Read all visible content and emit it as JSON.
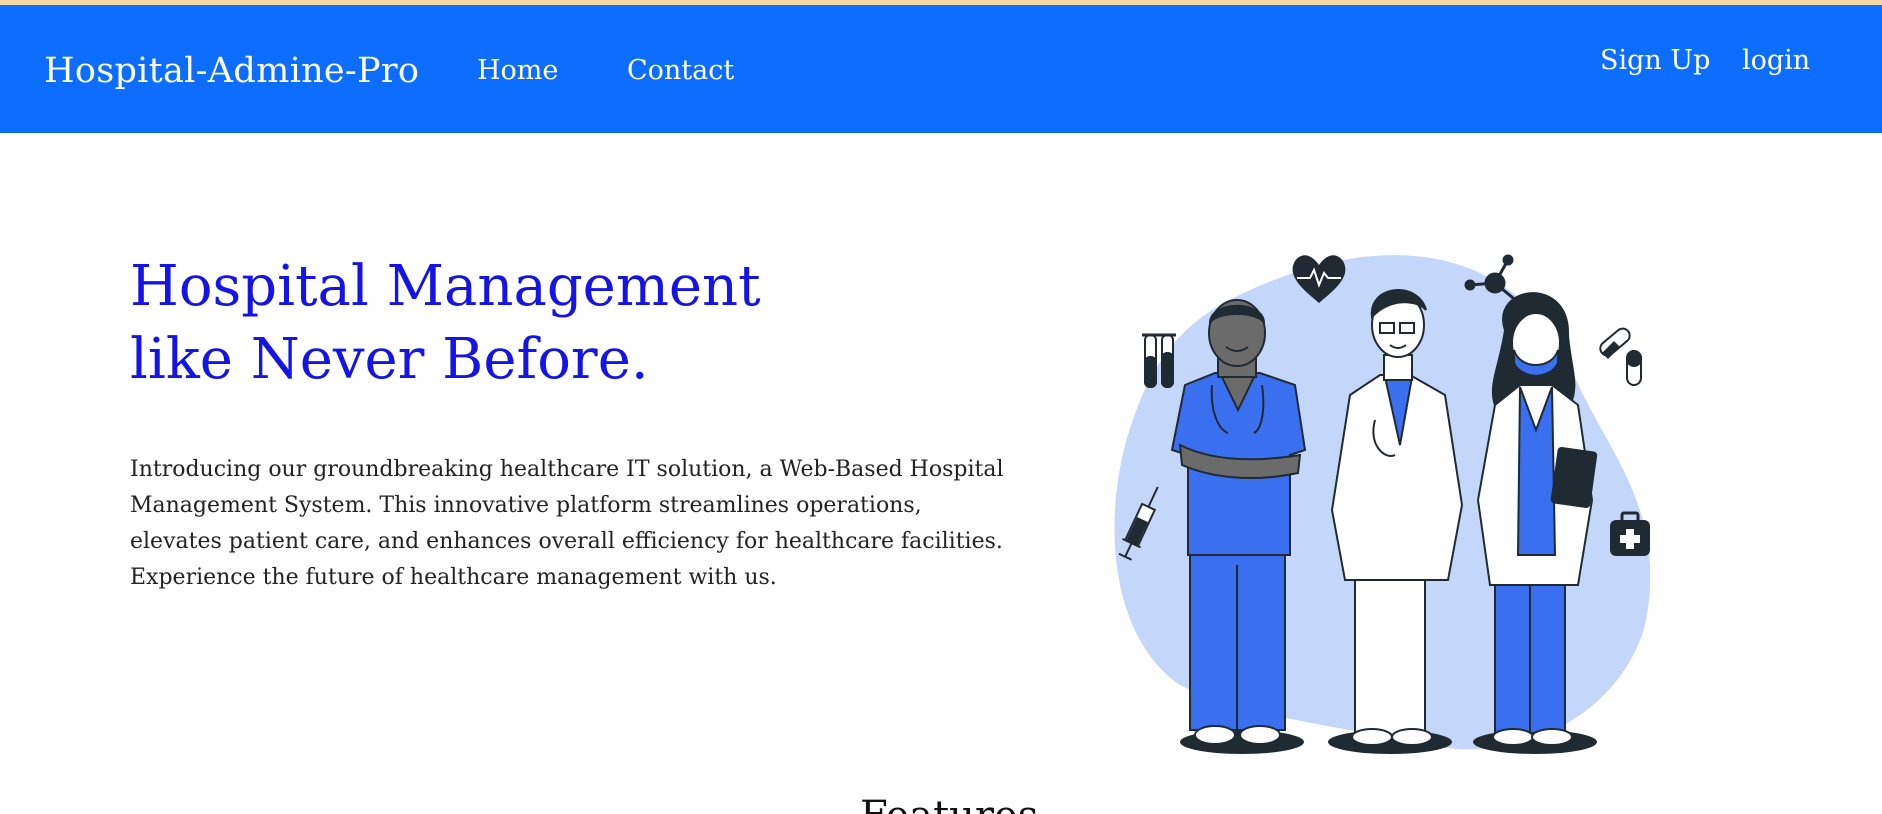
{
  "navbar": {
    "brand": "Hospital-Admine-Pro",
    "links": [
      "Home",
      "Contact"
    ],
    "auth": {
      "signup": "Sign Up",
      "login": "login"
    }
  },
  "hero": {
    "title_line1": "Hospital Management",
    "title_line2": "like Never Before.",
    "description": "Introducing our groundbreaking healthcare IT solution, a Web-Based Hospital Management System. This innovative platform streamlines operations, elevates patient care, and enhances overall efficiency for healthcare facilities. Experience the future of healthcare management with us."
  },
  "features": {
    "heading": "Features"
  },
  "colors": {
    "navbar_bg": "#0d6efd",
    "title_blue": "#1414e6",
    "illustration_blob": "#c5d6fb",
    "scrub_blue": "#3a6ff0",
    "ink": "#1f2a33"
  },
  "icons": [
    "heart-pulse-icon",
    "molecule-icon",
    "test-tubes-icon",
    "pills-icon",
    "syringe-icon",
    "medical-kit-icon"
  ]
}
